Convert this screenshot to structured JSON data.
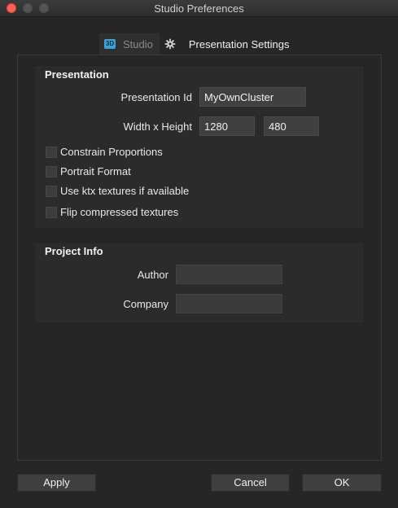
{
  "window": {
    "title": "Studio Preferences"
  },
  "tabs": [
    {
      "label": "Studio",
      "icon": "3d-studio-icon",
      "active": false
    },
    {
      "label": "Presentation Settings",
      "icon": "gear-icon",
      "active": true
    }
  ],
  "presentation": {
    "title": "Presentation",
    "id_label": "Presentation Id",
    "id_value": "MyOwnCluster",
    "size_label": "Width x Height",
    "width_value": "1280",
    "height_value": "480",
    "checkboxes": [
      {
        "label": "Constrain Proportions",
        "checked": false
      },
      {
        "label": "Portrait Format",
        "checked": false
      },
      {
        "label": "Use ktx textures if available",
        "checked": false
      },
      {
        "label": "Flip compressed textures",
        "checked": false
      }
    ]
  },
  "project_info": {
    "title": "Project Info",
    "author_label": "Author",
    "author_value": "",
    "company_label": "Company",
    "company_value": ""
  },
  "buttons": {
    "apply": "Apply",
    "cancel": "Cancel",
    "ok": "OK"
  },
  "colors": {
    "background": "#262626",
    "close_button": "#ff5f57",
    "icon_accent": "#3aa3d9"
  }
}
